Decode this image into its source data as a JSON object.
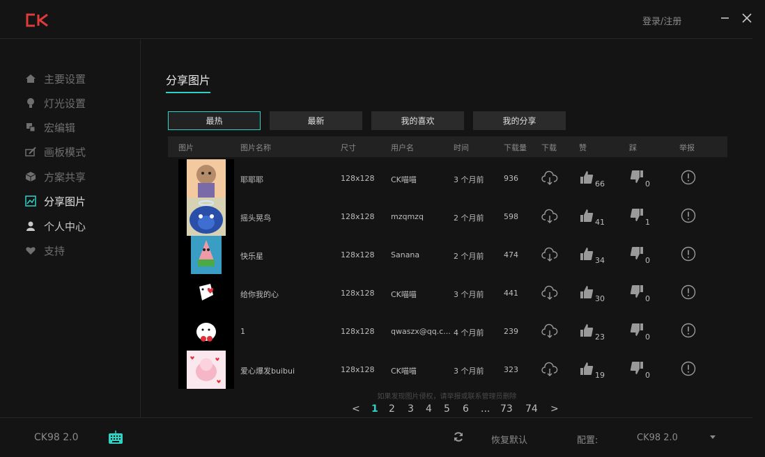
{
  "header": {
    "logo": "CK",
    "login_label": "登录/注册"
  },
  "sidebar": {
    "items": [
      {
        "label": "主要设置",
        "icon": "home-icon",
        "active": false
      },
      {
        "label": "灯光设置",
        "icon": "bulb-icon",
        "active": false
      },
      {
        "label": "宏编辑",
        "icon": "macro-icon",
        "active": false
      },
      {
        "label": "画板模式",
        "icon": "draw-icon",
        "active": false
      },
      {
        "label": "方案共享",
        "icon": "box-icon",
        "active": false
      },
      {
        "label": "分享图片",
        "icon": "image-share-icon",
        "active": true
      },
      {
        "label": "个人中心",
        "icon": "user-icon",
        "active": false
      },
      {
        "label": "支持",
        "icon": "heart-icon",
        "active": false
      }
    ]
  },
  "main": {
    "title": "分享图片",
    "filters": [
      {
        "label": "最热",
        "active": true
      },
      {
        "label": "最新",
        "active": false
      },
      {
        "label": "我的喜欢",
        "active": false
      },
      {
        "label": "我的分享",
        "active": false
      }
    ],
    "columns": [
      "图片",
      "图片名称",
      "尺寸",
      "用户名",
      "时间",
      "下载量",
      "下载",
      "赞",
      "踩",
      "举报"
    ],
    "rows": [
      {
        "name": "耶耶耶",
        "size": "128x128",
        "user": "CK喵喵",
        "time": "3 个月前",
        "downloads": "936",
        "likes": "66",
        "dislikes": "0"
      },
      {
        "name": "摇头晃鸟",
        "size": "128x128",
        "user": "mzqmzq",
        "time": "2 个月前",
        "downloads": "598",
        "likes": "41",
        "dislikes": "1"
      },
      {
        "name": "快乐星",
        "size": "128x128",
        "user": "Sanana",
        "time": "2 个月前",
        "downloads": "474",
        "likes": "34",
        "dislikes": "0"
      },
      {
        "name": "给你我的心",
        "size": "128x128",
        "user": "CK喵喵",
        "time": "3 个月前",
        "downloads": "441",
        "likes": "30",
        "dislikes": "0"
      },
      {
        "name": "1",
        "size": "128x128",
        "user": "qwaszx@qq.c...",
        "time": "4 个月前",
        "downloads": "239",
        "likes": "23",
        "dislikes": "0"
      },
      {
        "name": "爱心爆发buibui",
        "size": "128x128",
        "user": "CK喵喵",
        "time": "3 个月前",
        "downloads": "323",
        "likes": "19",
        "dislikes": "0"
      }
    ],
    "notice": "如果发现图片侵权，请举报或联系管理员删除",
    "pagination": {
      "prev": "<",
      "next": ">",
      "pages": [
        "1",
        "2",
        "3",
        "4",
        "5",
        "6",
        "...",
        "73",
        "74"
      ],
      "current": "1"
    }
  },
  "footer": {
    "model": "CK98 2.0",
    "restore_label": "恢复默认",
    "config_label": "配置:",
    "config_value": "CK98 2.0"
  },
  "colors": {
    "accent": "#2fd3c6",
    "brand_red": "#e03a3a",
    "background": "#141414"
  }
}
